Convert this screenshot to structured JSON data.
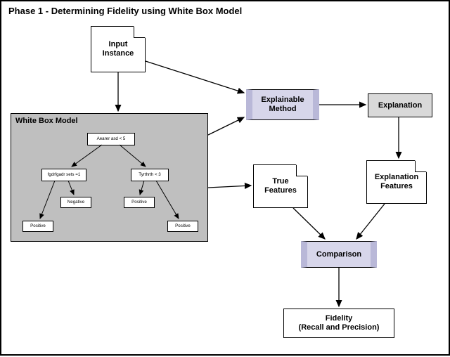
{
  "title": "Phase 1 - Determining Fidelity using White Box Model",
  "nodes": {
    "input_instance": "Input\nInstance",
    "explainable_method": "Explainable\nMethod",
    "explanation": "Explanation",
    "true_features": "True\nFeatures",
    "explanation_features": "Explanation\nFeatures",
    "comparison": "Comparison",
    "fidelity": "Fidelity\n(Recall and Precision)"
  },
  "whitebox": {
    "title": "White Box Model",
    "tree": {
      "root": "Aearer asd < 5",
      "left_split": "fgdrfgadr sets =1",
      "right_split": "Tyrthrth < 3",
      "left_leaf1": "Positive",
      "left_leaf2": "Negative",
      "right_leaf1": "Positive",
      "right_leaf2": "Positive"
    }
  }
}
